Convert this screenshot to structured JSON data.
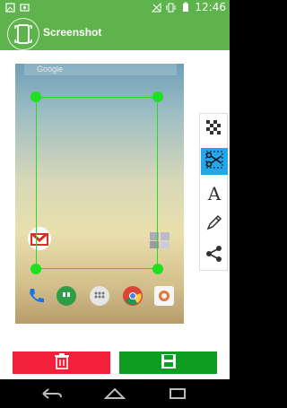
{
  "status_bar": {
    "time": "12:46",
    "left_icons": [
      "image-icon",
      "photo-icon"
    ],
    "right_icons": [
      "no-signal-icon",
      "vibrate-icon",
      "battery-icon"
    ]
  },
  "app_bar": {
    "title": "Screenshot",
    "icon": "phone-screenshot-icon"
  },
  "screenshot_preview": {
    "search_text": "Google",
    "dock_icons": [
      "phone-icon",
      "hangouts-icon",
      "apps-icon",
      "chrome-icon",
      "camera-icon"
    ],
    "home_icons": [
      "gmail-icon",
      "folder-icon"
    ]
  },
  "tools": [
    {
      "name": "pixelate-tool",
      "icon": "checkerboard-icon"
    },
    {
      "name": "crop-tool",
      "icon": "scissors-icon",
      "selected": true
    },
    {
      "name": "text-tool",
      "label": "A"
    },
    {
      "name": "draw-tool",
      "icon": "pencil-icon"
    },
    {
      "name": "share-tool",
      "icon": "share-icon"
    }
  ],
  "buttons": {
    "delete_icon": "trash-icon",
    "save_icon": "floppy-disk-icon"
  },
  "colors": {
    "primary": "#5fb34c",
    "delete": "#f2203a",
    "save": "#0f9d21",
    "crop_handles": "#1fe01f",
    "selected_tool": "#22a8ea"
  }
}
